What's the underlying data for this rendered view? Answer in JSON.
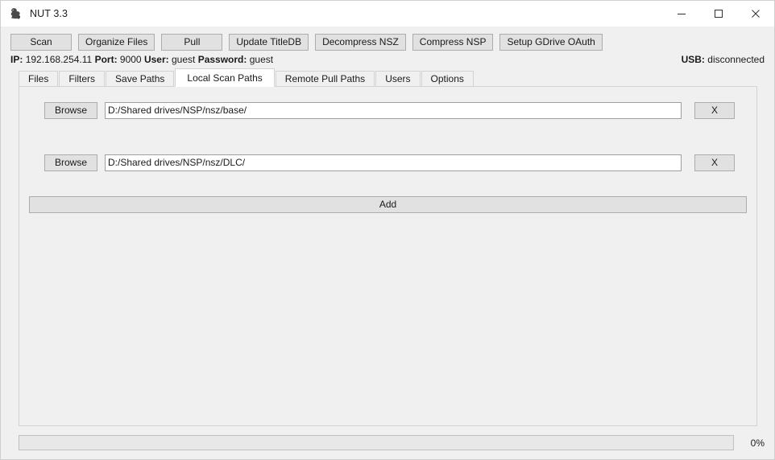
{
  "window": {
    "title": "NUT 3.3",
    "app_icon": "squirrel-icon",
    "controls": {
      "minimize": "minimize-icon",
      "maximize": "maximize-icon",
      "close": "close-icon"
    }
  },
  "toolbar": {
    "buttons": [
      {
        "label": "Scan",
        "name": "scan-button"
      },
      {
        "label": "Organize Files",
        "name": "organize-files-button"
      },
      {
        "label": "Pull",
        "name": "pull-button"
      },
      {
        "label": "Update TitleDB",
        "name": "update-titledb-button"
      },
      {
        "label": "Decompress NSZ",
        "name": "decompress-nsz-button"
      },
      {
        "label": "Compress NSP",
        "name": "compress-nsp-button"
      },
      {
        "label": "Setup GDrive OAuth",
        "name": "setup-gdrive-oauth-button"
      }
    ]
  },
  "status": {
    "ip_label": "IP:",
    "ip_value": "192.168.254.11",
    "port_label": "Port:",
    "port_value": "9000",
    "user_label": "User:",
    "user_value": "guest",
    "password_label": "Password:",
    "password_value": "guest",
    "usb_label": "USB:",
    "usb_value": "disconnected"
  },
  "tabs": [
    {
      "label": "Files",
      "active": false
    },
    {
      "label": "Filters",
      "active": false
    },
    {
      "label": "Save Paths",
      "active": false
    },
    {
      "label": "Local Scan Paths",
      "active": true
    },
    {
      "label": "Remote Pull Paths",
      "active": false
    },
    {
      "label": "Users",
      "active": false
    },
    {
      "label": "Options",
      "active": false
    }
  ],
  "local_scan_paths": {
    "browse_label": "Browse",
    "remove_label": "X",
    "add_label": "Add",
    "rows": [
      {
        "path": "D:/Shared drives/NSP/nsz/base/",
        "placeholder": ""
      },
      {
        "path": "D:/Shared drives/NSP/nsz/DLC/",
        "placeholder": ""
      }
    ]
  },
  "progress": {
    "percent": 0,
    "label": "0%"
  }
}
